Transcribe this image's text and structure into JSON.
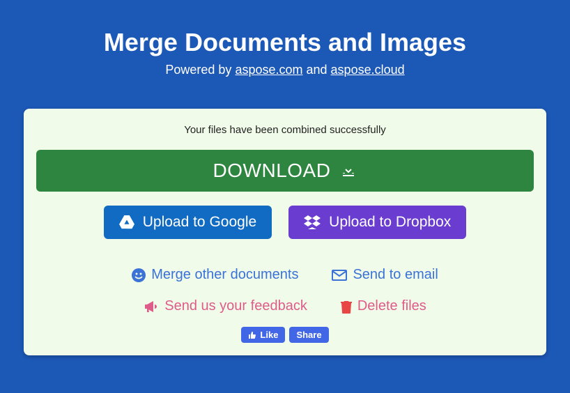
{
  "header": {
    "title": "Merge Documents and Images",
    "powered_prefix": "Powered by ",
    "link1": "aspose.com",
    "and": " and ",
    "link2": "aspose.cloud"
  },
  "card": {
    "status": "Your files have been combined successfully",
    "download": "DOWNLOAD",
    "upload_google": "Upload to Google",
    "upload_dropbox": "Upload to Dropbox",
    "merge_other": "Merge other documents",
    "send_email": "Send to email",
    "feedback": "Send us your feedback",
    "delete": "Delete files"
  },
  "social": {
    "like": "Like",
    "share": "Share"
  }
}
